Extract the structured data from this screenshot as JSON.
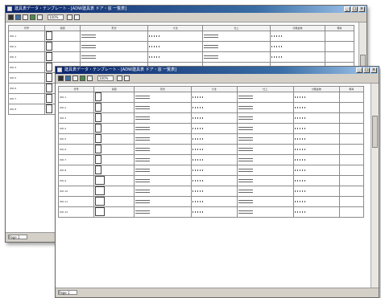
{
  "windows": [
    {
      "id": "back",
      "title": "建具表データ・テンプレート - [ADW建具表 ドア・窓 一覧表]",
      "zoom": "100%",
      "page": "Page 1",
      "controls": [
        "_",
        "□",
        "×"
      ]
    },
    {
      "id": "front",
      "title": "建具表データ・テンプレート - [ADW建具表 ドア・窓 一覧表]",
      "zoom": "100%",
      "page": "Page 1",
      "controls": [
        "_",
        "□",
        "×"
      ]
    }
  ],
  "table": {
    "headers": [
      "符号",
      "姿図",
      "形式",
      "寸法",
      "仕上",
      "付属金物",
      "備考"
    ],
    "front_rows": [
      "WD-1",
      "WD-2",
      "WD-3",
      "WD-4",
      "WD-5",
      "WD-6",
      "WD-7",
      "WD-8",
      "WD-9",
      "WD-10",
      "WD-11",
      "WD-12"
    ],
    "back_rows": [
      "WD-1",
      "WD-2",
      "WD-3",
      "WD-4",
      "WD-5",
      "WD-6",
      "WD-7",
      "WD-8"
    ]
  },
  "colors": {
    "titlebar_start": "#0a246a",
    "titlebar_end": "#a6caf0",
    "chrome": "#d4d0c8"
  }
}
